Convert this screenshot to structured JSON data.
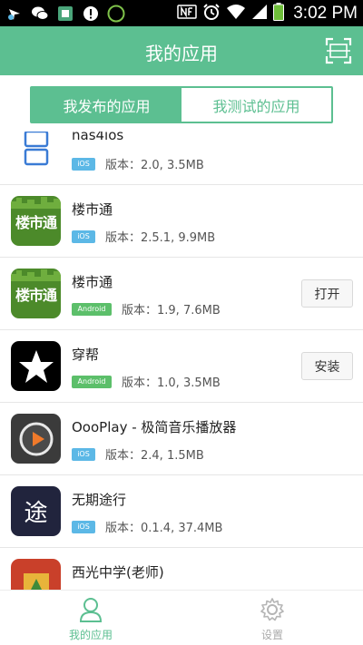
{
  "status_bar": {
    "time": "3:02 PM",
    "icons": [
      "location-icon",
      "wechat-icon",
      "app-notify-icon",
      "alert-icon",
      "badge-75-icon",
      "nfc-icon",
      "alarm-icon",
      "wifi-icon",
      "signal-icon",
      "battery-icon"
    ],
    "badge_text": "75"
  },
  "header": {
    "title": "我的应用",
    "scan_icon": "scan-icon"
  },
  "tabs": [
    {
      "label": "我发布的应用",
      "active": true
    },
    {
      "label": "我测试的应用",
      "active": false
    }
  ],
  "apps": [
    {
      "name": "nas4ios",
      "platform": "iOS",
      "version": "版本：2.0, 3.5MB",
      "action": ""
    },
    {
      "name": "楼市通",
      "platform": "iOS",
      "version": "版本：2.5.1, 9.9MB",
      "action": "",
      "icon_text": "楼市通"
    },
    {
      "name": "楼市通",
      "platform": "Android",
      "version": "版本：1.9, 7.6MB",
      "action": "打开",
      "icon_text": "楼市通"
    },
    {
      "name": "穿帮",
      "platform": "Android",
      "version": "版本：1.0, 3.5MB",
      "action": "安装"
    },
    {
      "name": "OooPlay - 极简音乐播放器",
      "platform": "iOS",
      "version": "版本：2.4, 1.5MB",
      "action": ""
    },
    {
      "name": "无期途行",
      "platform": "iOS",
      "version": "版本：0.1.4, 37.4MB",
      "action": "",
      "icon_text": "途"
    },
    {
      "name": "西光中学(老师)",
      "platform": "",
      "version": "",
      "action": ""
    }
  ],
  "bottom_nav": [
    {
      "label": "我的应用",
      "icon": "user-icon",
      "active": true
    },
    {
      "label": "设置",
      "icon": "gear-icon",
      "active": false
    }
  ],
  "colors": {
    "brand_green": "#5cbf91",
    "ios_badge": "#5cb8e6",
    "android_badge": "#5cbf6a"
  }
}
